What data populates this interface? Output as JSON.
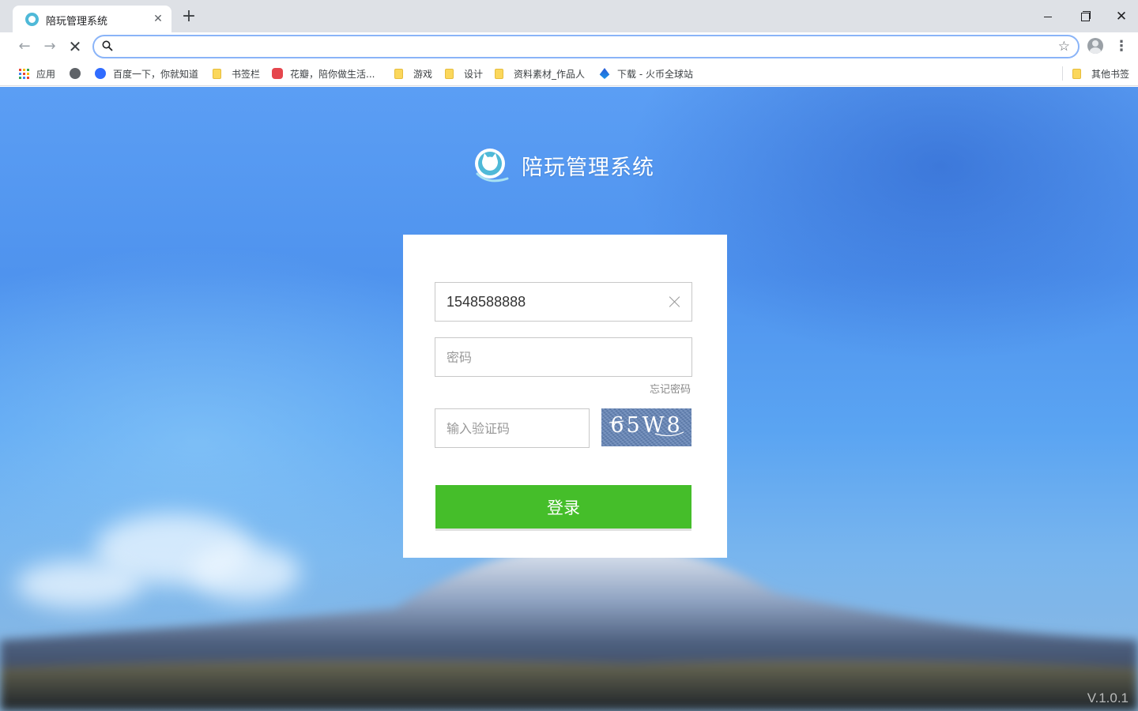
{
  "browser": {
    "tab": {
      "title": "陪玩管理系统",
      "close": "✕",
      "favicon": "cat-logo-icon"
    },
    "new_tab": "+",
    "window_controls": {
      "close": "✕"
    },
    "nav": {
      "back": "←",
      "forward": "→",
      "stop": "✕"
    },
    "omnibox": {
      "value": "",
      "star": "☆"
    },
    "menu": "⋮",
    "bookmarks": [
      {
        "label": "应用",
        "icon": "apps-grid-icon"
      },
      {
        "label": "",
        "icon": "globe-icon"
      },
      {
        "label": "百度一下，你就知道",
        "icon": "baidu-paw-icon"
      },
      {
        "label": "书签栏",
        "icon": "folder-icon"
      },
      {
        "label": "花瓣，陪你做生活...",
        "icon": "huaban-icon"
      },
      {
        "label": "游戏",
        "icon": "folder-icon"
      },
      {
        "label": "设计",
        "icon": "folder-icon"
      },
      {
        "label": "资料素材_作品人",
        "icon": "folder-icon"
      },
      {
        "label": "下载 - 火币全球站",
        "icon": "huobi-icon"
      },
      {
        "label": "其他书签",
        "icon": "folder-icon"
      }
    ]
  },
  "app": {
    "title": "陪玩管理系统",
    "version": "V.1.0.1"
  },
  "login": {
    "username_value": "1548588888",
    "password_placeholder": "密码",
    "forgot_label": "忘记密码",
    "captcha_placeholder": "输入验证码",
    "captcha_text": "65W8",
    "submit_label": "登录"
  },
  "colors": {
    "primary_button": "#45be2a",
    "tabstrip": "#dee1e6",
    "focus_ring": "#8ab4f8"
  }
}
